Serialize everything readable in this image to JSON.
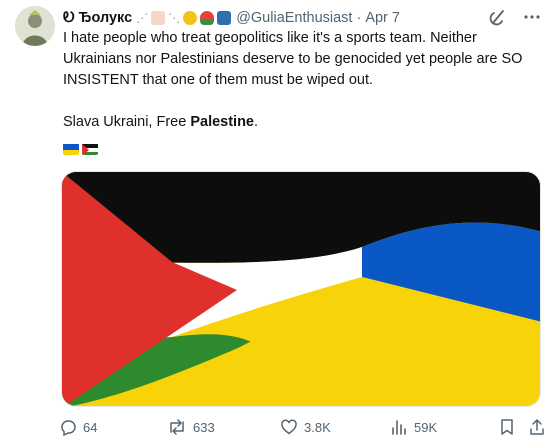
{
  "tweet": {
    "author": {
      "display_name": "Ꭷ Ђолукс",
      "handle": "@GuliaEnthusiast",
      "date": "Apr 7",
      "separator": "·"
    },
    "text": {
      "line1": "I hate people who treat geopolitics like it's a sports team. Neither Ukrainians nor Palestinians deserve to be genocided yet people are SO INSISTENT that one of them must be wiped out.",
      "line2_prefix": "Slava Ukraini, Free ",
      "line2_bold": "Palestine",
      "line2_suffix": "."
    },
    "stats": {
      "replies": "64",
      "reposts": "633",
      "likes": "3.8K",
      "views": "59K"
    },
    "colors": {
      "palestine_red": "#e0302c",
      "palestine_green": "#2e8a2e",
      "ukraine_blue": "#0a58c6",
      "ukraine_yellow": "#f8d30a",
      "muted": "#536471"
    },
    "icons": [
      "grok-icon",
      "more-icon",
      "reply-icon",
      "repost-icon",
      "like-icon",
      "views-icon",
      "bookmark-icon",
      "share-icon"
    ]
  }
}
